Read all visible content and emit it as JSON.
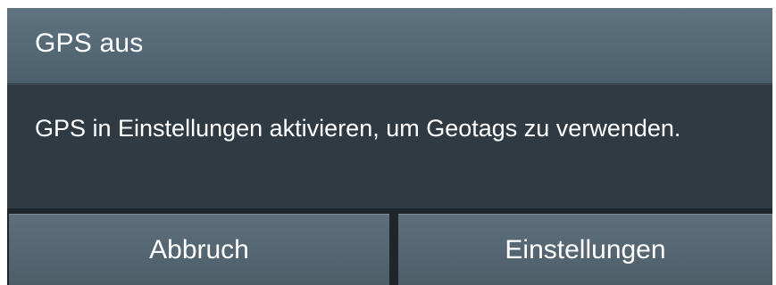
{
  "dialog": {
    "title": "GPS aus",
    "message": "GPS in Einstellungen aktivieren, um Geotags zu verwenden.",
    "buttons": {
      "cancel_label": "Abbruch",
      "settings_label": "Einstellungen"
    }
  },
  "colors": {
    "titlebar": "#556874",
    "body": "#2f3a43",
    "button": "#566873",
    "text": "#ffffff"
  }
}
